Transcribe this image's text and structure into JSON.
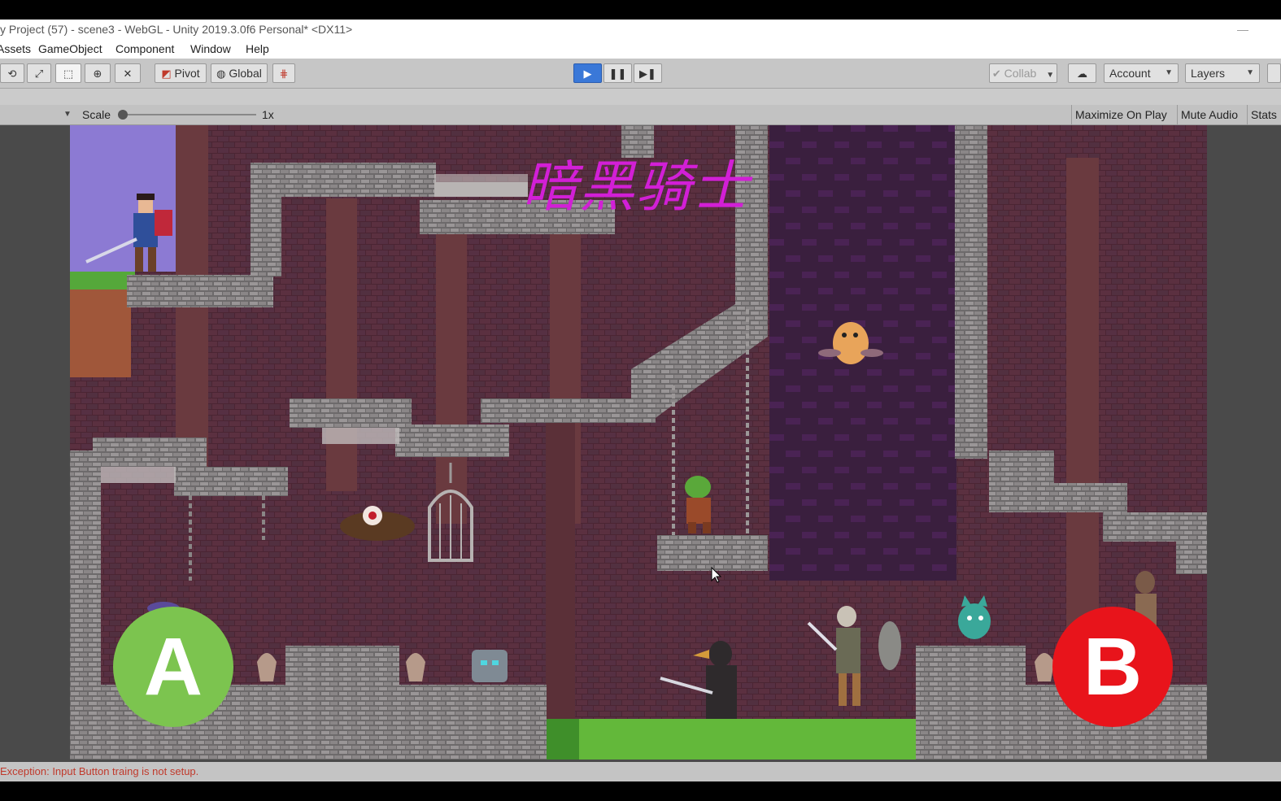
{
  "window": {
    "title": "y Project (57) - scene3 - WebGL - Unity 2019.3.0f6 Personal* <DX11>",
    "minimize_glyph": "—"
  },
  "menu": {
    "items": [
      "Assets",
      "GameObject",
      "Component",
      "Window",
      "Help"
    ]
  },
  "toolbar": {
    "pivot_label": "Pivot",
    "global_label": "Global",
    "collab_label": "Collab",
    "account_label": "Account",
    "layers_label": "Layers"
  },
  "game_view": {
    "scale_label": "Scale",
    "scale_value": "1x",
    "maximize_label": "Maximize On Play",
    "mute_label": "Mute Audio",
    "stats_label": "Stats"
  },
  "game": {
    "title_text": "暗黑骑士",
    "button_a": "A",
    "button_b": "B",
    "colors": {
      "title": "#d21fd6",
      "button_a": "#7cc44f",
      "button_b": "#e8141b",
      "ground_highlight": "#63b83a",
      "sky": "#8c7ad3",
      "brick": "#5a2e3e",
      "stone": "#8e8a89"
    }
  },
  "status": {
    "message": "Exception: Input Button traing is not setup."
  }
}
